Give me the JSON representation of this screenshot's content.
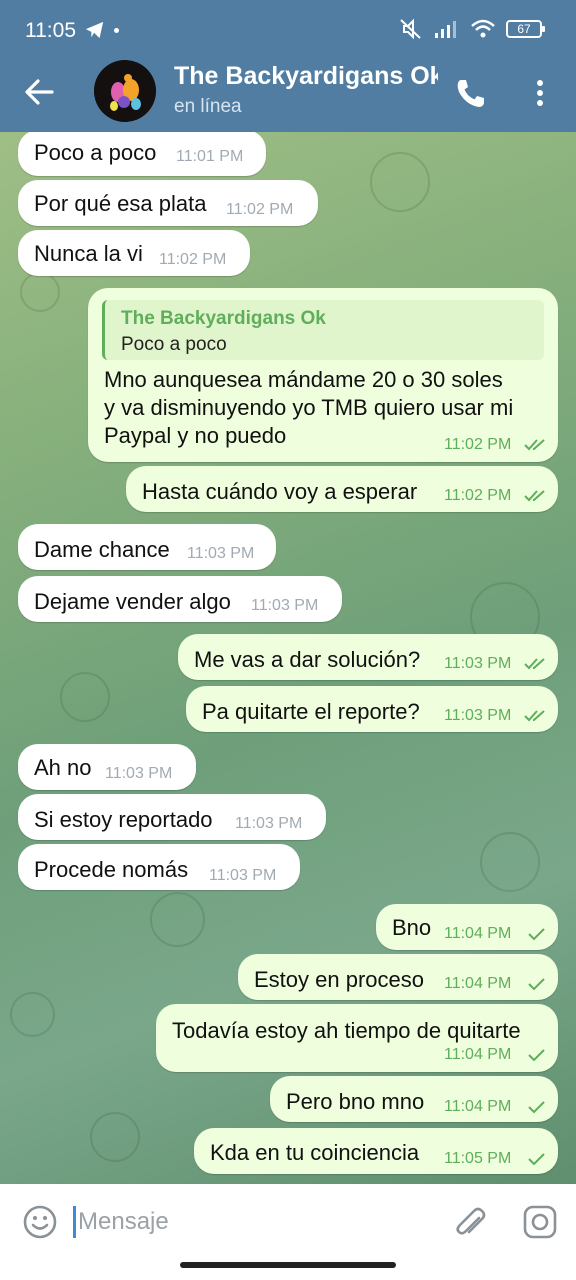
{
  "status_bar": {
    "time": "11:05",
    "battery": "67",
    "icons": [
      "telegram-icon",
      "dot-icon",
      "mute-icon",
      "signal-icon",
      "wifi-icon",
      "battery-icon"
    ]
  },
  "header": {
    "title": "The Backyardigans Ok",
    "status": "en línea",
    "back_icon": "arrow-left-icon",
    "call_icon": "phone-icon",
    "menu_icon": "more-vertical-icon"
  },
  "messages": [
    {
      "dir": "in",
      "text": "Poco a poco",
      "time": "11:01 PM"
    },
    {
      "dir": "in",
      "text": "Por qué esa plata",
      "time": "11:02 PM"
    },
    {
      "dir": "in",
      "text": "Nunca la vi",
      "time": "11:02 PM"
    },
    {
      "dir": "out",
      "reply_name": "The Backyardigans Ok",
      "reply_text": "Poco a poco",
      "lines": [
        "Mno aunquesea mándame 20 o 30 soles",
        "y va disminuyendo yo TMB quiero usar mi",
        "Paypal y no puedo"
      ],
      "time": "11:02 PM",
      "read": true
    },
    {
      "dir": "out",
      "text": "Hasta cuándo voy a esperar",
      "time": "11:02 PM",
      "read": true
    },
    {
      "dir": "in",
      "text": "Dame chance",
      "time": "11:03 PM"
    },
    {
      "dir": "in",
      "text": "Dejame vender algo",
      "time": "11:03 PM"
    },
    {
      "dir": "out",
      "text": "Me vas a dar solución?",
      "time": "11:03 PM",
      "read": true
    },
    {
      "dir": "out",
      "text": "Pa quitarte el reporte?",
      "time": "11:03 PM",
      "read": true
    },
    {
      "dir": "in",
      "text": "Ah no",
      "time": "11:03 PM"
    },
    {
      "dir": "in",
      "text": "Si estoy reportado",
      "time": "11:03 PM"
    },
    {
      "dir": "in",
      "text": "Procede nomás",
      "time": "11:03 PM"
    },
    {
      "dir": "out",
      "text": "Bno",
      "time": "11:04 PM",
      "read": false
    },
    {
      "dir": "out",
      "text": "Estoy en proceso",
      "time": "11:04 PM",
      "read": false
    },
    {
      "dir": "out",
      "text": "Todavía estoy ah tiempo de quitarte",
      "time": "11:04 PM",
      "read": false
    },
    {
      "dir": "out",
      "text": "Pero bno mno",
      "time": "11:04 PM",
      "read": false
    },
    {
      "dir": "out",
      "text": "Kda en tu coinciencia",
      "time": "11:05 PM",
      "read": false
    }
  ],
  "composer": {
    "placeholder": "Mensaje",
    "emoji_icon": "emoji-icon",
    "attach_icon": "paperclip-icon",
    "camera_icon": "camera-icon"
  },
  "colors": {
    "header": "#517da2",
    "incoming": "#ffffff",
    "outgoing": "#effedd",
    "outgoing_time": "#5fae5c",
    "accent": "#3e8ad4"
  }
}
